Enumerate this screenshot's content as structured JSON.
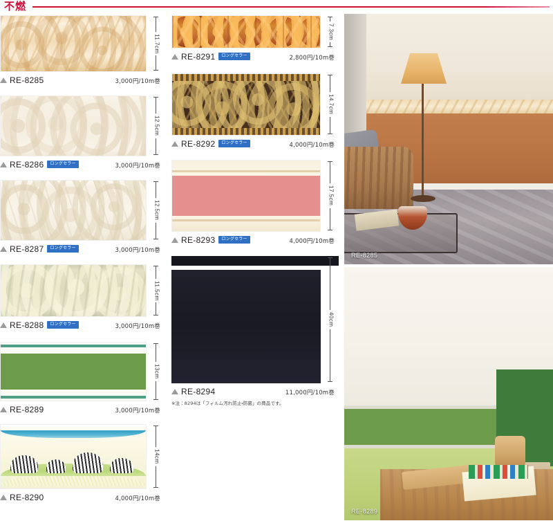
{
  "header": {
    "label": "不燃",
    "accent_color": "#d2103c"
  },
  "labels": {
    "badge_long_seller": "ロングセラー",
    "triangle_icon": "triangle-icon"
  },
  "columns": {
    "left": [
      {
        "code": "RE-8285",
        "price": "3,000円/10m巻",
        "dimension": "11.7cm",
        "badge": "",
        "pattern": "beige-scroll-relief"
      },
      {
        "code": "RE-8286",
        "price": "3,000円/10m巻",
        "dimension": "12.5cm",
        "badge": "ロングセラー",
        "pattern": "ivory-tonal-scroll"
      },
      {
        "code": "RE-8287",
        "price": "3,000円/10m巻",
        "dimension": "12.5cm",
        "badge": "ロングセラー",
        "pattern": "cream-embossed-scroll"
      },
      {
        "code": "RE-8288",
        "price": "3,000円/10m巻",
        "dimension": "11.5cm",
        "badge": "ロングセラー",
        "pattern": "sage-acanthus-relief"
      },
      {
        "code": "RE-8289",
        "price": "3,000円/10m巻",
        "dimension": "13cm",
        "badge": "",
        "pattern": "green-ivy-vine"
      },
      {
        "code": "RE-8290",
        "price": "4,000円/10m巻",
        "dimension": "14cm",
        "badge": "",
        "pattern": "zebra-savanna-kids"
      }
    ],
    "middle": [
      {
        "code": "RE-8291",
        "price": "2,800円/10m巻",
        "dimension": "7.3cm",
        "badge": "ロングセラー",
        "pattern": "terracotta-diamond"
      },
      {
        "code": "RE-8292",
        "price": "4,000円/10m巻",
        "dimension": "14.7cm",
        "badge": "ロングセラー",
        "pattern": "gold-baroque-damask"
      },
      {
        "code": "RE-8293",
        "price": "4,000円/10m巻",
        "dimension": "17.5cm",
        "badge": "ロングセラー",
        "pattern": "pink-rose-floral"
      },
      {
        "code": "RE-8294",
        "price": "11,000円/10m巻",
        "dimension": "40cm",
        "badge": "",
        "pattern": "solid-dark-navy",
        "note": "※注：8294は「フィルム汚れ防止・防菌」の商品です。"
      }
    ],
    "right": [
      {
        "label": "RE-8285",
        "scene": "living-room-floor-lamp-sofa"
      },
      {
        "label": "RE-8289",
        "scene": "ivy-border-green-wall-table"
      }
    ]
  }
}
